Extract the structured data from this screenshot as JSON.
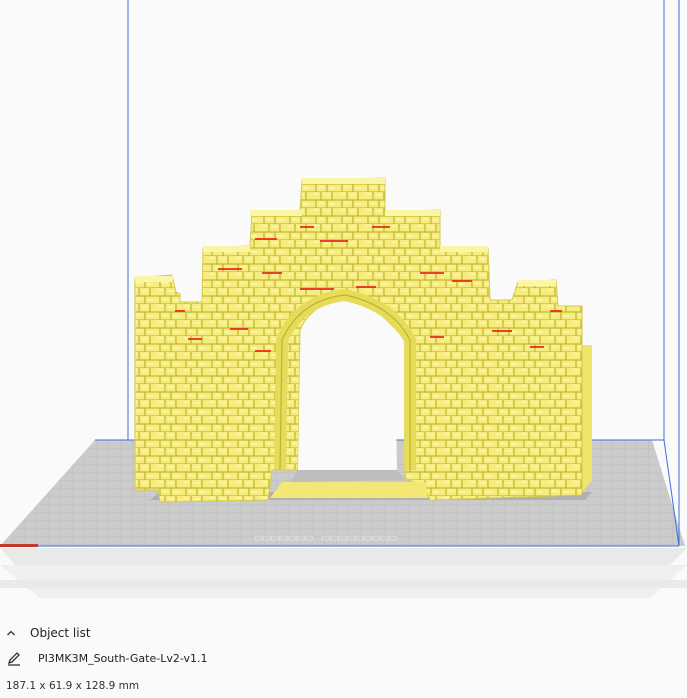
{
  "object_list": {
    "header": "Object list",
    "item_name": "PI3MK3M_South-Gate-Lv2-v1.1",
    "dimensions": "187.1 x 61.9 x 128.9 mm"
  },
  "colors": {
    "model_yellow": "#f6ed7e",
    "model_shadow": "#c9bf3f",
    "overhang_red": "#e8241c",
    "build_volume_blue": "#3c6fd8",
    "plate_grey": "#c6c6c6",
    "grid_line": "#b4b4b4"
  }
}
